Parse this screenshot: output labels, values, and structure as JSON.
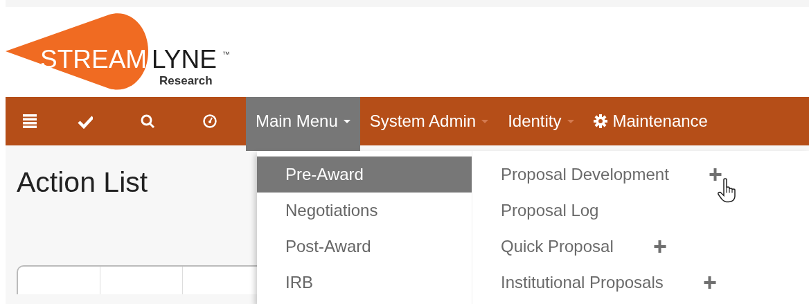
{
  "logo": {
    "word_1": "STREAM",
    "word_2": "LYNE",
    "mark": "™",
    "subtitle": "Research"
  },
  "nav": {
    "icons": [
      {
        "kind": "list"
      },
      {
        "kind": "check"
      },
      {
        "kind": "search"
      },
      {
        "kind": "dashboard"
      }
    ],
    "menus": [
      {
        "label": "Main Menu",
        "selected": true,
        "kind": "dropdown"
      },
      {
        "label": "System Admin",
        "selected": false,
        "kind": "dropdown"
      },
      {
        "label": "Identity",
        "selected": false,
        "kind": "dropdown"
      },
      {
        "label": "Maintenance",
        "selected": false,
        "kind": "settings"
      }
    ]
  },
  "page": {
    "title": "Action List"
  },
  "dropdown": {
    "categories": [
      {
        "label": "Pre-Award",
        "selected": true
      },
      {
        "label": "Negotiations",
        "selected": false
      },
      {
        "label": "Post-Award",
        "selected": false
      },
      {
        "label": "IRB",
        "selected": false
      }
    ],
    "links": [
      {
        "label": "Proposal Development",
        "plus": true,
        "hovered": true
      },
      {
        "label": "Proposal Log",
        "plus": false,
        "hovered": false
      },
      {
        "label": "Quick Proposal",
        "plus": true,
        "hovered": false
      },
      {
        "label": "Institutional Proposals",
        "plus": true,
        "hovered": false
      }
    ]
  }
}
